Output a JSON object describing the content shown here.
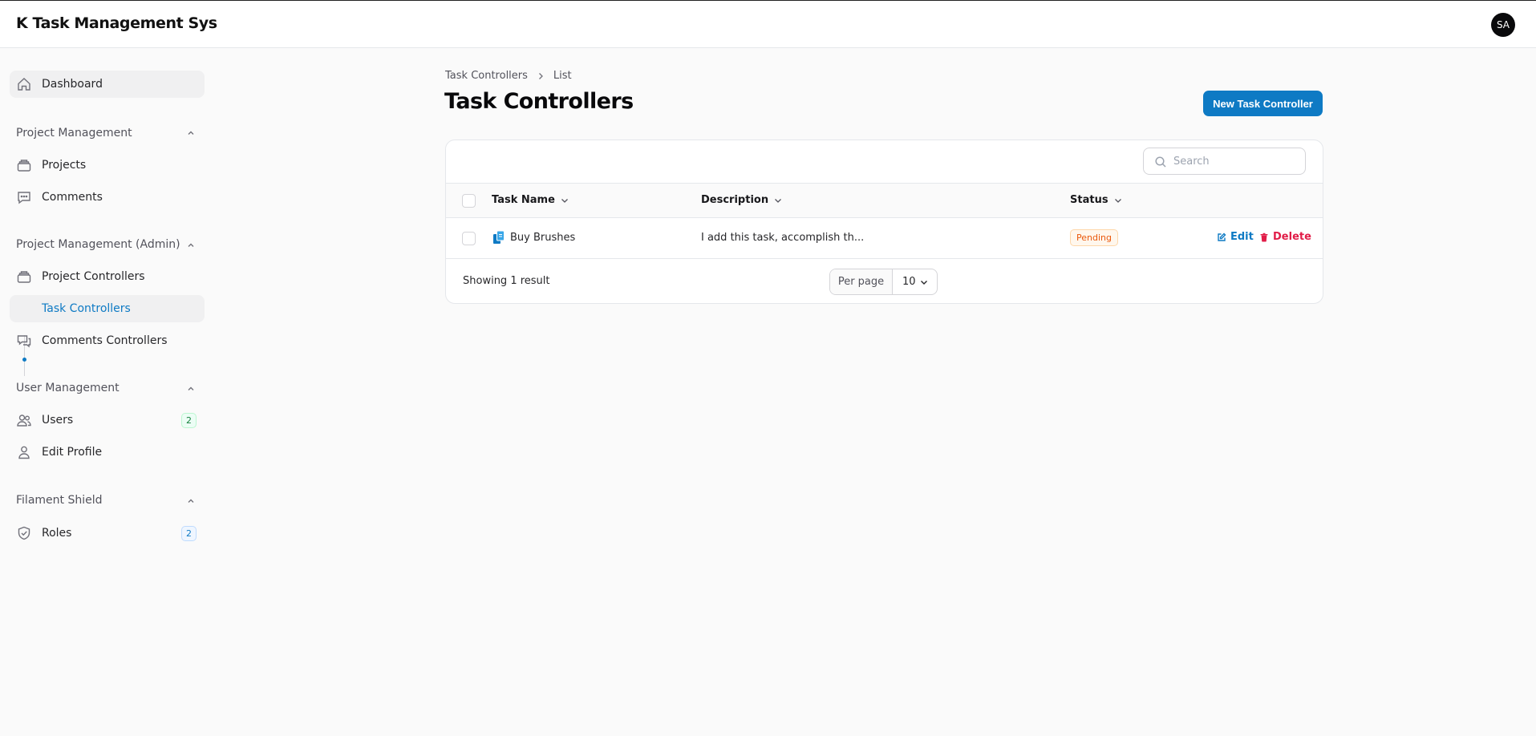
{
  "app": {
    "title": "K Task Management Sys",
    "avatar_initials": "SA"
  },
  "sidebar": {
    "dashboard": {
      "label": "Dashboard",
      "icon": "home-icon"
    },
    "groups": [
      {
        "label": "Project Management",
        "items": [
          {
            "label": "Projects",
            "icon": "stack-icon"
          },
          {
            "label": "Comments",
            "icon": "chat-bubble-icon"
          }
        ]
      },
      {
        "label": "Project Management (Admin)",
        "items": [
          {
            "label": "Project Controllers",
            "icon": "stack-icon"
          },
          {
            "label": "Task Controllers",
            "icon": "dot-icon",
            "active": true
          },
          {
            "label": "Comments Controllers",
            "icon": "chat-bubbles-icon"
          }
        ]
      },
      {
        "label": "User Management",
        "items": [
          {
            "label": "Users",
            "icon": "users-icon",
            "badge": "2"
          },
          {
            "label": "Edit Profile",
            "icon": "user-icon"
          }
        ]
      },
      {
        "label": "Filament Shield",
        "items": [
          {
            "label": "Roles",
            "icon": "shield-check-icon",
            "badge": "2"
          }
        ]
      }
    ]
  },
  "breadcrumb": {
    "parent": "Task Controllers",
    "current": "List"
  },
  "page": {
    "title": "Task Controllers",
    "new_button": "New Task Controller"
  },
  "table": {
    "search_placeholder": "Search",
    "columns": [
      "Task Name",
      "Description",
      "Status"
    ],
    "rows": [
      {
        "task_name": "Buy Brushes",
        "description": "I add this task, accomplish th...",
        "status": "Pending",
        "edit_label": "Edit",
        "delete_label": "Delete"
      }
    ],
    "footer": {
      "summary": "Showing 1 result",
      "per_page_label": "Per page",
      "per_page_value": "10"
    }
  },
  "colors": {
    "primary": "#0e7ac4",
    "danger": "#e11d48",
    "warning": "#ea580c"
  }
}
